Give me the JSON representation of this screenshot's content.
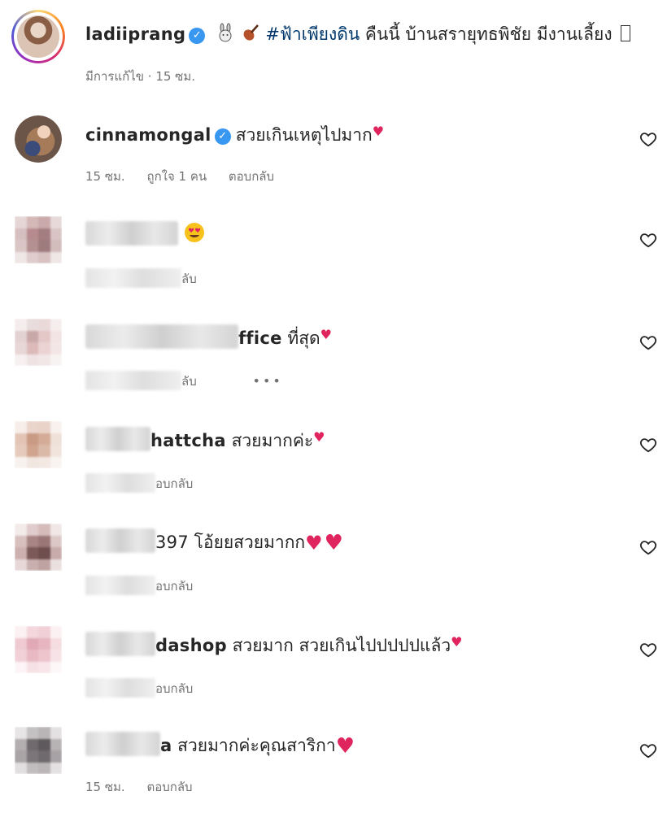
{
  "post": {
    "username": "ladiiprang",
    "verified": true,
    "hashtag": "#ฟ้าเพียงดิน",
    "caption": "คืนนี้ บ้านสรายุทธพิชัย มีงานเลี้ยง",
    "edited": "มีการแก้ไข",
    "time": "15 ซม."
  },
  "comments": [
    {
      "username": "cinnamongal",
      "verified": true,
      "text": "สวยเกินเหตุไปมาก",
      "time": "15 ซม.",
      "likes": "ถูกใจ 1 คน",
      "reply": "ตอบกลับ"
    },
    {
      "username": "",
      "text": "",
      "reply": "ลับ"
    },
    {
      "username": "ffice",
      "text": "ที่สุด",
      "reply": "ลับ",
      "more": "•••"
    },
    {
      "username": "hattcha",
      "text": "สวยมากค่ะ",
      "reply": "อบกลับ"
    },
    {
      "username": "397",
      "text": "โอ้ยยสวยมากก",
      "reply": "อบกลับ"
    },
    {
      "username": "dashop",
      "text": "สวยมาก สวยเกินไปปปปปแล้ว",
      "reply": "อบกลับ"
    },
    {
      "username": "a",
      "text": "สวยมากค่ะคุณสาริกา",
      "time": "15 ซม.",
      "reply": "ตอบกลับ"
    }
  ],
  "icons": {
    "heart": "heart-outline-icon",
    "verified": "verified-badge-icon",
    "more": "more-options-icon"
  },
  "colors": {
    "verified": "#3897f0",
    "hashtag": "#00376b",
    "meta": "#737373",
    "heart_emoji": "#e0245e"
  }
}
